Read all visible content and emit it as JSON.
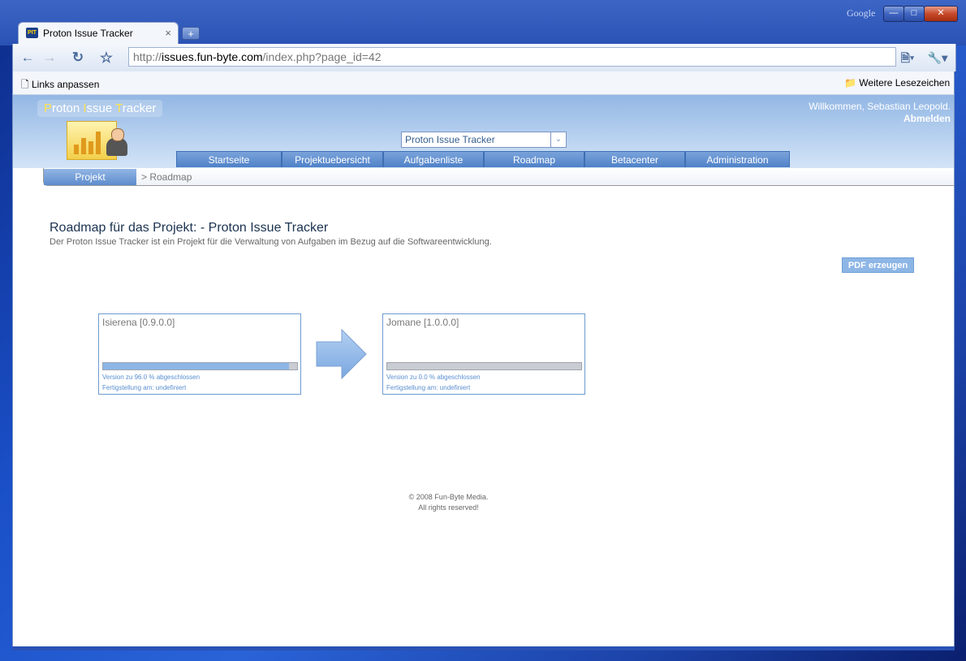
{
  "browser": {
    "google_label": "Google",
    "tab_title": "Proton Issue Tracker",
    "tab_favicon": "PIT",
    "url_prefix": "http://",
    "url_domain": "issues.fun-byte.com",
    "url_path": "/index.php?page_id=42",
    "bookmark_left": "Links anpassen",
    "bookmark_right": "Weitere Lesezeichen"
  },
  "app": {
    "logo_letters": [
      "P",
      "roton ",
      "I",
      "ssue ",
      "T",
      "racker"
    ],
    "welcome": "Willkommen, Sebastian Leopold.",
    "logout": "Abmelden",
    "project_select": "Proton Issue Tracker",
    "nav": [
      "Startseite",
      "Projektuebersicht",
      "Aufgabenliste",
      "Roadmap",
      "Betacenter",
      "Administration"
    ],
    "subnav_project": "Projekt",
    "breadcrumb": "> Roadmap"
  },
  "content": {
    "heading": "Roadmap für das Projekt: - Proton Issue Tracker",
    "description": "Der Proton Issue Tracker ist ein Projekt für die Verwaltung von Aufgaben im Bezug auf die Softwareentwicklung.",
    "pdf_button": "PDF erzeugen",
    "versions": [
      {
        "name": "Isierena [0.9.0.0]",
        "progress": 96.0,
        "status": "Version zu 96.0  % abgeschlossen",
        "finish": "Fertigstellung am: undefiniert"
      },
      {
        "name": "Jomane [1.0.0.0]",
        "progress": 0.0,
        "status": "Version zu 0.0  % abgeschlossen",
        "finish": "Fertigstellung am: undefiniert"
      }
    ]
  },
  "footer": {
    "line1": "© 2008 Fun-Byte Media.",
    "line2": "All rights reserved!"
  },
  "colors": {
    "accent": "#8db6e6",
    "header": "#93b7e4"
  }
}
